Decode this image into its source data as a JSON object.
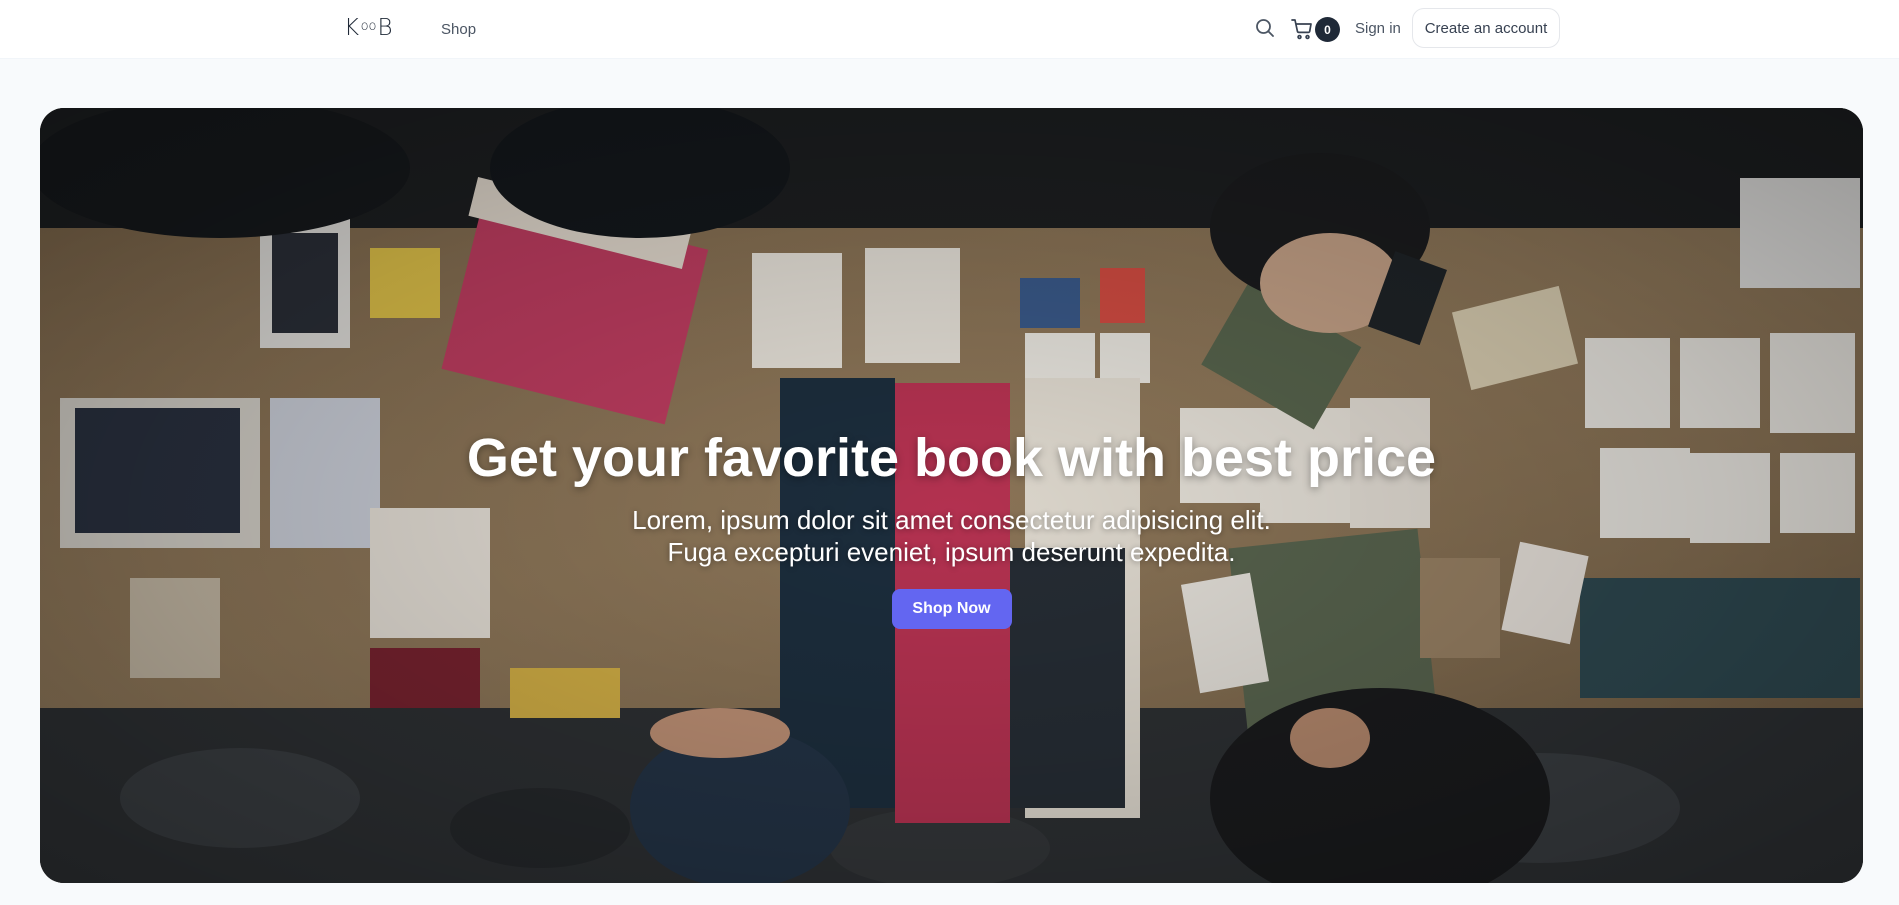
{
  "header": {
    "logo_text": "KOOB",
    "nav": [
      {
        "label": "Shop"
      }
    ],
    "cart_count": "0",
    "sign_in_label": "Sign in",
    "create_account_label": "Create an account",
    "icons": [
      "search-icon",
      "cart-icon"
    ]
  },
  "hero": {
    "title": "Get your favorite book with best price",
    "subtitle_line1": "Lorem, ipsum dolor sit amet consectetur adipisicing elit.",
    "subtitle_line2": "Fuga excepturi eveniet, ipsum deserunt expedita.",
    "cta_label": "Shop Now"
  },
  "colors": {
    "accent": "#6366f1",
    "badge": "#1f2937",
    "page_bg": "#f8fafc"
  }
}
